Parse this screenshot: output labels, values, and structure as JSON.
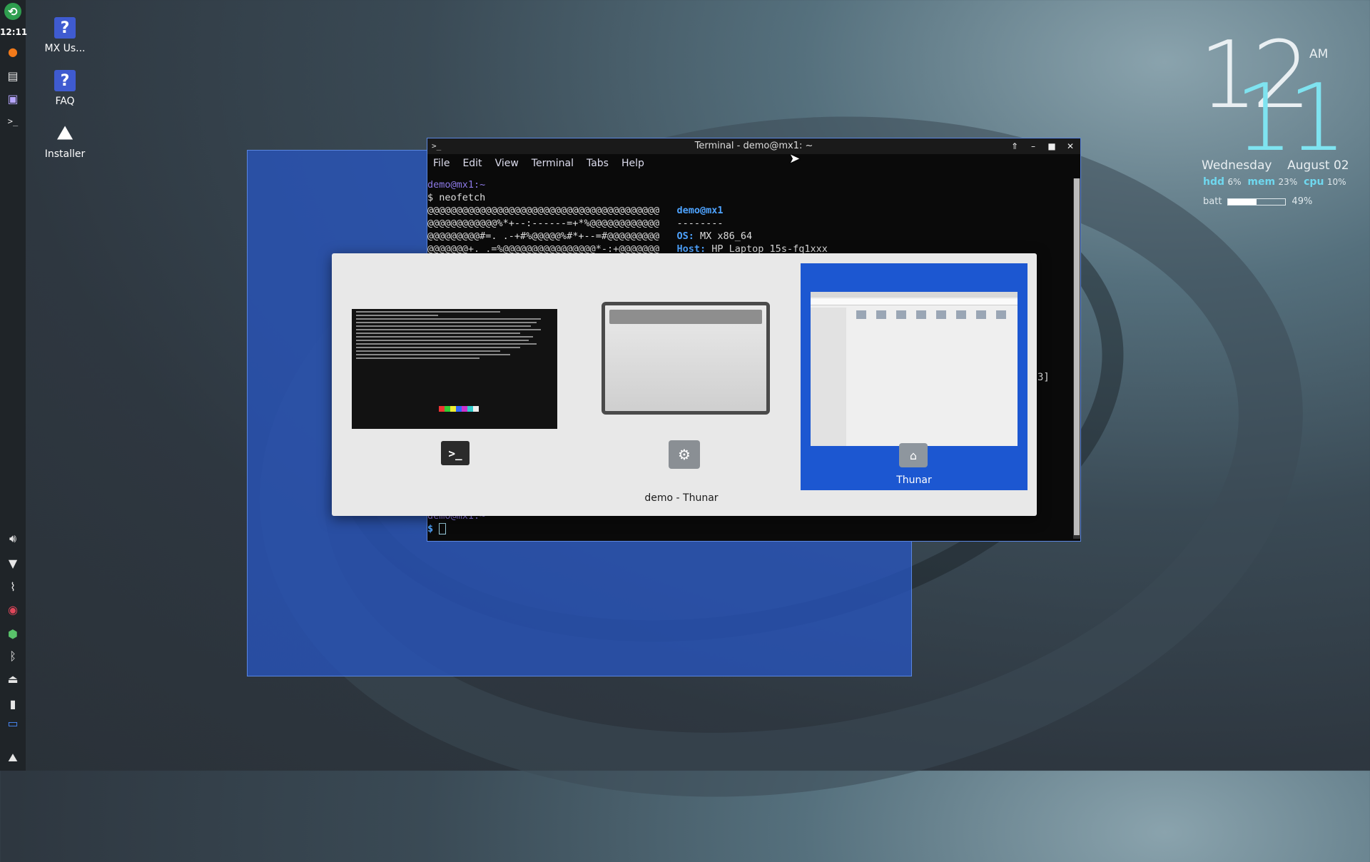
{
  "panel": {
    "clock": "12:11",
    "top_icons": [
      "refresh-icon",
      "firefox-icon",
      "files-icon",
      "display-icon",
      "terminal-icon"
    ],
    "bottom_icons": [
      "volume-icon",
      "wifi-icon",
      "clip-icon",
      "record-icon",
      "package-icon",
      "bluetooth-icon",
      "eject-icon",
      "battery-icon",
      "keyboard-icon",
      "mx-logo-icon"
    ]
  },
  "desktop_icons": [
    {
      "label": "MX Us...",
      "icon": "help-icon"
    },
    {
      "label": "FAQ",
      "icon": "help-icon"
    },
    {
      "label": "Installer",
      "icon": "installer-icon"
    }
  ],
  "conky": {
    "hour": "12",
    "minute": "11",
    "ampm": "AM",
    "weekday": "Wednesday",
    "date": "August 02",
    "hdd_label": "hdd",
    "hdd_value": "6%",
    "mem_label": "mem",
    "mem_value": "23%",
    "cpu_label": "cpu",
    "cpu_value": "10%",
    "batt_label": "batt",
    "batt_value": "49%",
    "batt_level": 0.49
  },
  "terminal": {
    "title": "Terminal - demo@mx1: ~",
    "menu": [
      "File",
      "Edit",
      "View",
      "Terminal",
      "Tabs",
      "Help"
    ],
    "prompt_user": "demo@mx1:~",
    "command": "$ neofetch",
    "art": [
      "@@@@@@@@@@@@@@@@@@@@@@@@@@@@@@@@@@@@@@@@",
      "@@@@@@@@@@@@%*+--:------=+*%@@@@@@@@@@@@",
      "@@@@@@@@@#=. .-+#%@@@@@%#*+--=#@@@@@@@@@",
      "@@@@@@@+. .=%@@@@@@@@@@@@@@@@*-:+@@@@@@@"
    ],
    "info_header": "demo@mx1",
    "info_sep": "--------",
    "os_label": "OS:",
    "os_value": "MX x86_64",
    "host_label": "Host:",
    "host_value": "HP Laptop 15s-fq1xxx",
    "side_fragment": "3]",
    "bottom_prompt_user": "demo@mx1:~",
    "bottom_prompt": "$"
  },
  "switcher": {
    "items": [
      {
        "label": "",
        "icon": "terminal-app-icon"
      },
      {
        "label": "demo - Thunar",
        "icon": "thunar-settings-icon"
      },
      {
        "label": "Thunar",
        "icon": "home-folder-icon",
        "selected": true
      }
    ]
  }
}
